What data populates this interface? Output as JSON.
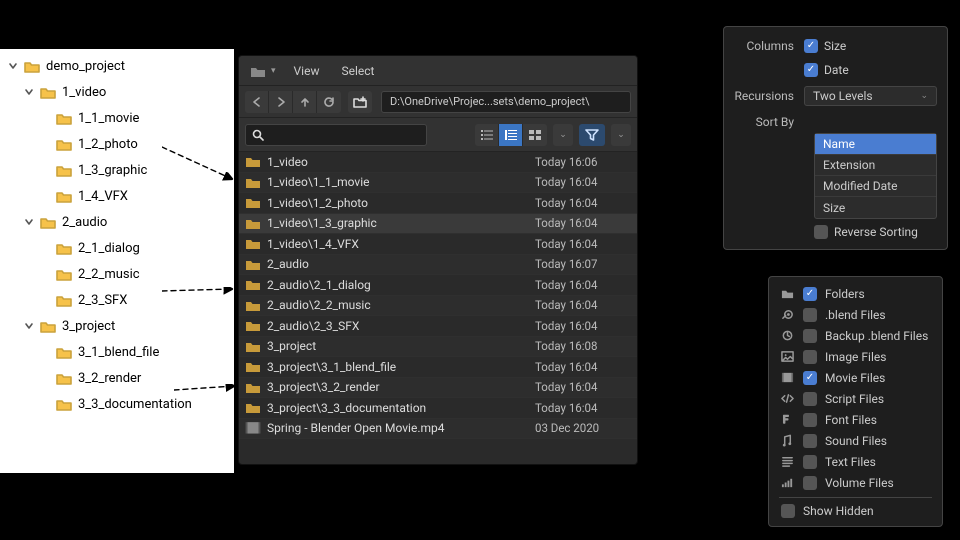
{
  "tree": {
    "root": "demo_project",
    "items": [
      {
        "name": "1_video",
        "children": [
          "1_1_movie",
          "1_2_photo",
          "1_3_graphic",
          "1_4_VFX"
        ]
      },
      {
        "name": "2_audio",
        "children": [
          "2_1_dialog",
          "2_2_music",
          "2_3_SFX"
        ]
      },
      {
        "name": "3_project",
        "children": [
          "3_1_blend_file",
          "3_2_render",
          "3_3_documentation"
        ]
      }
    ]
  },
  "browser": {
    "menu": {
      "view": "View",
      "select": "Select"
    },
    "path": "D:\\OneDrive\\Projec...sets\\demo_project\\",
    "files": [
      {
        "name": "1_video",
        "date": "Today 16:06",
        "type": "folder"
      },
      {
        "name": "1_video\\1_1_movie",
        "date": "Today 16:04",
        "type": "folder"
      },
      {
        "name": "1_video\\1_2_photo",
        "date": "Today 16:04",
        "type": "folder"
      },
      {
        "name": "1_video\\1_3_graphic",
        "date": "Today 16:04",
        "type": "folder",
        "selected": true
      },
      {
        "name": "1_video\\1_4_VFX",
        "date": "Today 16:04",
        "type": "folder"
      },
      {
        "name": "2_audio",
        "date": "Today 16:07",
        "type": "folder"
      },
      {
        "name": "2_audio\\2_1_dialog",
        "date": "Today 16:04",
        "type": "folder"
      },
      {
        "name": "2_audio\\2_2_music",
        "date": "Today 16:04",
        "type": "folder"
      },
      {
        "name": "2_audio\\2_3_SFX",
        "date": "Today 16:04",
        "type": "folder"
      },
      {
        "name": "3_project",
        "date": "Today 16:08",
        "type": "folder"
      },
      {
        "name": "3_project\\3_1_blend_file",
        "date": "Today 16:04",
        "type": "folder"
      },
      {
        "name": "3_project\\3_2_render",
        "date": "Today 16:04",
        "type": "folder"
      },
      {
        "name": "3_project\\3_3_documentation",
        "date": "Today 16:04",
        "type": "folder"
      },
      {
        "name": "Spring - Blender Open Movie.mp4",
        "date": "03 Dec 2020",
        "type": "movie"
      }
    ]
  },
  "settings": {
    "columns_label": "Columns",
    "size_label": "Size",
    "date_label": "Date",
    "recursions_label": "Recursions",
    "recursions_value": "Two Levels",
    "sortby_label": "Sort By",
    "sort_options": [
      "Name",
      "Extension",
      "Modified Date",
      "Size"
    ],
    "sort_active": "Name",
    "reverse_label": "Reverse Sorting"
  },
  "filter": {
    "items": [
      {
        "icon": "folder",
        "label": "Folders",
        "checked": true
      },
      {
        "icon": "blend",
        "label": ".blend Files",
        "checked": false
      },
      {
        "icon": "backup",
        "label": "Backup .blend Files",
        "checked": false
      },
      {
        "icon": "image",
        "label": "Image Files",
        "checked": false
      },
      {
        "icon": "movie",
        "label": "Movie Files",
        "checked": true
      },
      {
        "icon": "script",
        "label": "Script Files",
        "checked": false
      },
      {
        "icon": "font",
        "label": "Font Files",
        "checked": false
      },
      {
        "icon": "sound",
        "label": "Sound Files",
        "checked": false
      },
      {
        "icon": "text",
        "label": "Text Files",
        "checked": false
      },
      {
        "icon": "volume",
        "label": "Volume Files",
        "checked": false
      }
    ],
    "show_hidden_label": "Show Hidden"
  }
}
